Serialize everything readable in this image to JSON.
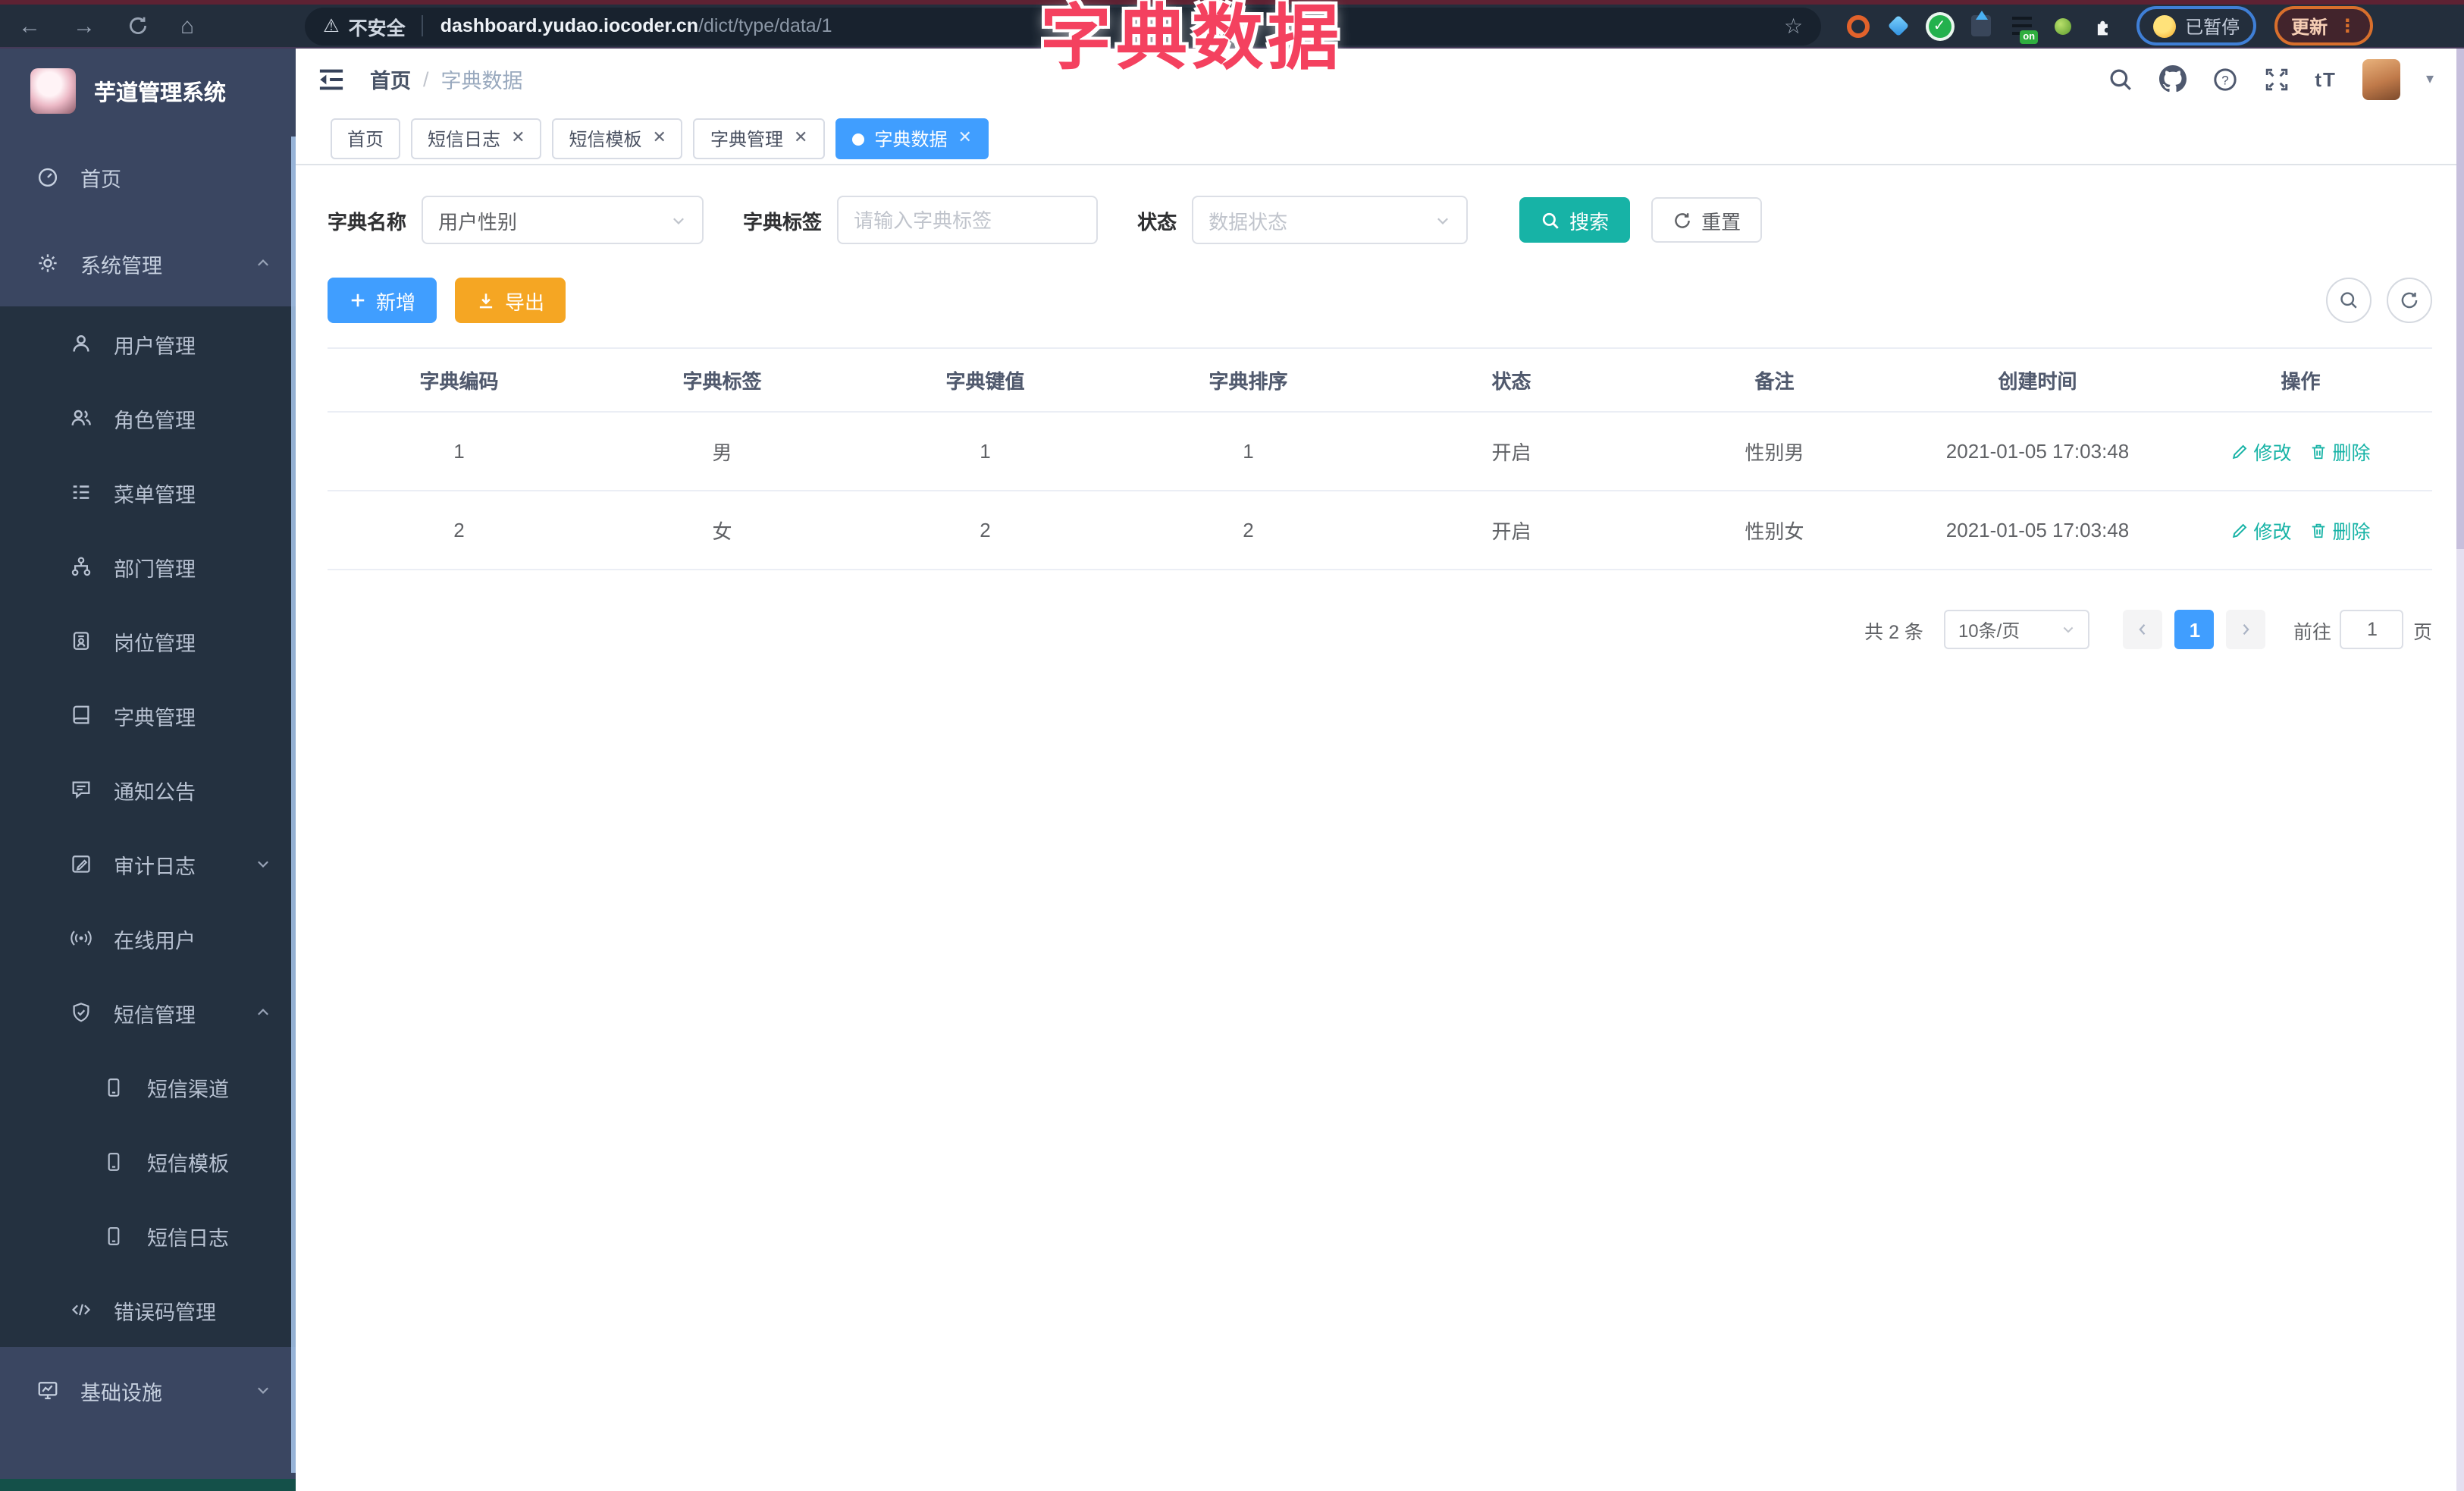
{
  "overlay_title": "字典数据",
  "browser": {
    "security_label": "不安全",
    "url_domain": "dashboard.yudao.iocoder.cn",
    "url_path": "/dict/type/data/1",
    "paused_badge": "已暂停",
    "update_button": "更新"
  },
  "sidebar": {
    "app_title": "芋道管理系统",
    "items": [
      {
        "label": "首页",
        "icon": "dashboard-icon",
        "level": 1
      },
      {
        "label": "系统管理",
        "icon": "gear-icon",
        "level": 1,
        "chevron": "up"
      },
      {
        "label": "用户管理",
        "icon": "user-icon",
        "level": 2
      },
      {
        "label": "角色管理",
        "icon": "users-icon",
        "level": 2
      },
      {
        "label": "菜单管理",
        "icon": "menu-list-icon",
        "level": 2
      },
      {
        "label": "部门管理",
        "icon": "org-tree-icon",
        "level": 2
      },
      {
        "label": "岗位管理",
        "icon": "id-badge-icon",
        "level": 2
      },
      {
        "label": "字典管理",
        "icon": "dictionary-icon",
        "level": 2
      },
      {
        "label": "通知公告",
        "icon": "announcement-icon",
        "level": 2
      },
      {
        "label": "审计日志",
        "icon": "audit-log-icon",
        "level": 2,
        "chevron": "down"
      },
      {
        "label": "在线用户",
        "icon": "online-users-icon",
        "level": 2
      },
      {
        "label": "短信管理",
        "icon": "sms-shield-icon",
        "level": 2,
        "chevron": "up"
      },
      {
        "label": "短信渠道",
        "icon": "phone-icon",
        "level": 3
      },
      {
        "label": "短信模板",
        "icon": "phone-icon",
        "level": 3
      },
      {
        "label": "短信日志",
        "icon": "phone-icon",
        "level": 3
      },
      {
        "label": "错误码管理",
        "icon": "code-icon",
        "level": 2
      },
      {
        "label": "基础设施",
        "icon": "monitor-icon",
        "level": 1,
        "chevron": "down"
      }
    ]
  },
  "header": {
    "breadcrumb": {
      "home": "首页",
      "separator": "/",
      "current": "字典数据"
    },
    "icons": [
      "search-icon",
      "github-icon",
      "help-icon",
      "fullscreen-icon",
      "font-size-icon",
      "avatar",
      "chevron-down-icon"
    ]
  },
  "tabs": [
    {
      "label": "首页",
      "closable": false,
      "active": false
    },
    {
      "label": "短信日志",
      "closable": true,
      "active": false
    },
    {
      "label": "短信模板",
      "closable": true,
      "active": false
    },
    {
      "label": "字典管理",
      "closable": true,
      "active": false
    },
    {
      "label": "字典数据",
      "closable": true,
      "active": true
    }
  ],
  "filters": {
    "name_label": "字典名称",
    "name_value": "用户性别",
    "tag_label": "字典标签",
    "tag_placeholder": "请输入字典标签",
    "status_label": "状态",
    "status_placeholder": "数据状态",
    "search_label": "搜索",
    "reset_label": "重置"
  },
  "toolbar": {
    "add_label": "新增",
    "export_label": "导出"
  },
  "table": {
    "headers": [
      "字典编码",
      "字典标签",
      "字典键值",
      "字典排序",
      "状态",
      "备注",
      "创建时间",
      "操作"
    ],
    "rows": [
      {
        "code": "1",
        "label": "男",
        "value": "1",
        "sort": "1",
        "status": "开启",
        "remark": "性别男",
        "created_at": "2021-01-05 17:03:48"
      },
      {
        "code": "2",
        "label": "女",
        "value": "2",
        "sort": "2",
        "status": "开启",
        "remark": "性别女",
        "created_at": "2021-01-05 17:03:48"
      }
    ],
    "edit_label": "修改",
    "delete_label": "删除"
  },
  "pagination": {
    "total": "共 2 条",
    "size": "10条/页",
    "page": "1",
    "goto_label": "前往",
    "goto_value": "1",
    "page_unit": "页"
  },
  "colors": {
    "accent_teal": "#17b3a6",
    "accent_blue": "#409eff",
    "accent_orange": "#f5a623",
    "annotation_red": "#f4415f",
    "sidebar_root_bg": "#3a4661",
    "sidebar_sub_bg": "#243140"
  }
}
